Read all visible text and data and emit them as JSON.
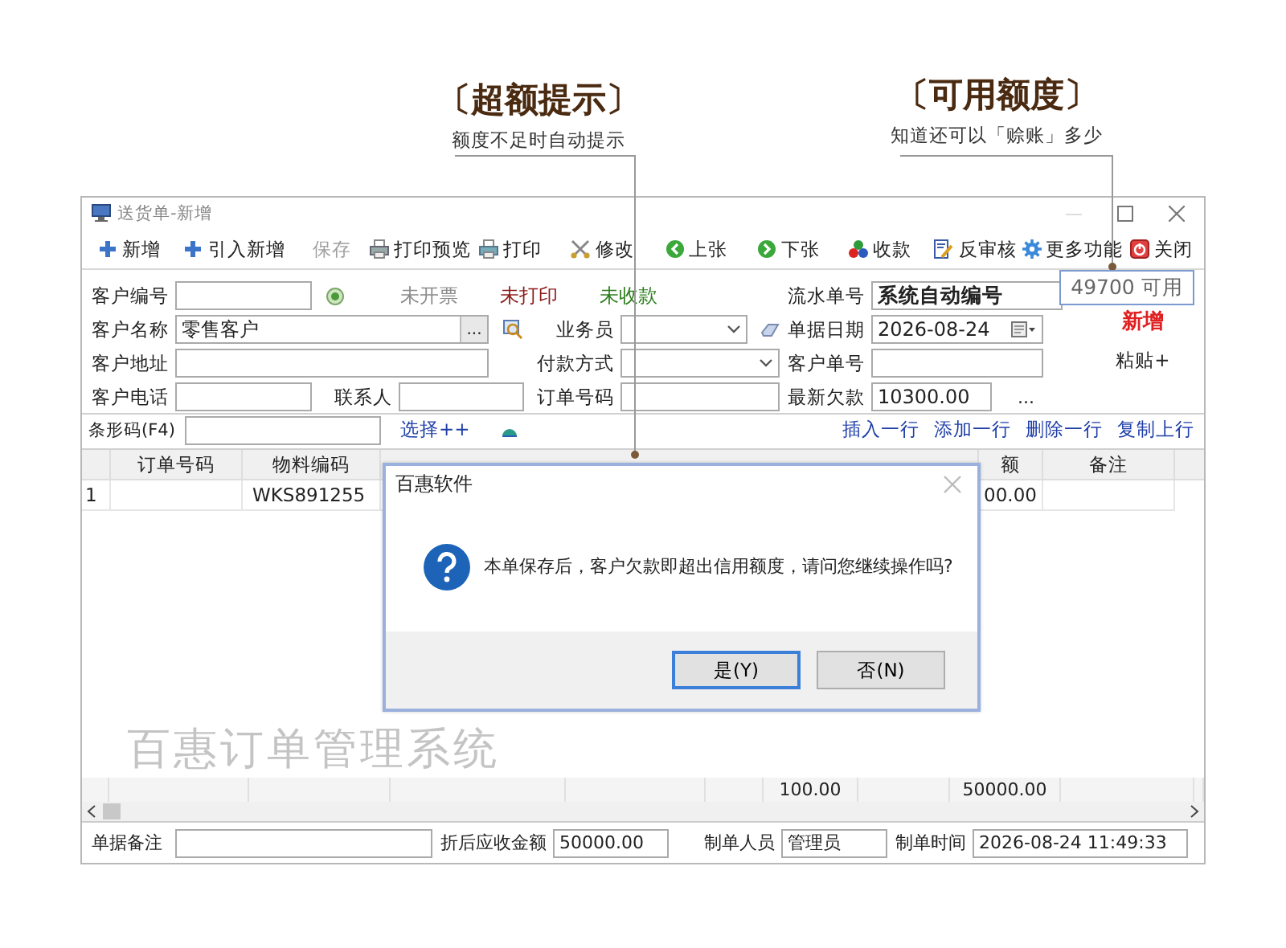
{
  "annotations": [
    {
      "title": "〔超额提示〕",
      "subtitle": "额度不足时自动提示"
    },
    {
      "title": "〔可用额度〕",
      "subtitle": "知道还可以「赊账」多少"
    }
  ],
  "available_hint": "49700 可用",
  "window": {
    "title": "送货单-新增"
  },
  "toolbar": [
    {
      "label": "新增",
      "disabled": false
    },
    {
      "label": "引入新增",
      "disabled": false
    },
    {
      "label": "保存",
      "disabled": true
    },
    {
      "label": "打印预览",
      "disabled": false
    },
    {
      "label": "打印",
      "disabled": false
    },
    {
      "label": "修改",
      "disabled": false
    },
    {
      "label": "上张",
      "disabled": false
    },
    {
      "label": "下张",
      "disabled": false
    },
    {
      "label": "收款",
      "disabled": false
    },
    {
      "label": "反审核",
      "disabled": false
    },
    {
      "label": "更多功能",
      "disabled": false
    },
    {
      "label": "关闭",
      "disabled": false
    }
  ],
  "status_flags": [
    {
      "label": "未开票",
      "color": "#8c8c8c"
    },
    {
      "label": "未打印",
      "color": "#8b1a1a"
    },
    {
      "label": "未收款",
      "color": "#2e7d1e"
    }
  ],
  "form": {
    "fields": [
      {
        "kind": "text",
        "label": "客户编号"
      },
      {
        "kind": "text",
        "label": "流水单号",
        "value": "系统自动编号",
        "bold": true
      },
      {
        "kind": "lookup",
        "label": "客户名称",
        "value": "零售客户",
        "button": "..."
      },
      {
        "kind": "select",
        "label": "业务员"
      },
      {
        "kind": "date",
        "label": "单据日期",
        "value": "2026-08-24"
      },
      {
        "kind": "text",
        "label": "客户地址"
      },
      {
        "kind": "select",
        "label": "付款方式"
      },
      {
        "kind": "text",
        "label": "客户单号"
      },
      {
        "kind": "text",
        "label": "客户电话"
      },
      {
        "kind": "text",
        "label": "联系人"
      },
      {
        "kind": "text",
        "label": "订单号码"
      },
      {
        "kind": "text",
        "label": "最新欠款",
        "value": "10300.00"
      }
    ],
    "more_button": "...",
    "mode_badge": "新增",
    "paste_link": "粘贴+"
  },
  "barcode": {
    "label": "条形码(F4)",
    "select_link": "选择++"
  },
  "row_actions": [
    "插入一行",
    "添加一行",
    "删除一行",
    "复制上行"
  ],
  "table": {
    "columns": [
      "订单号码",
      "物料编码",
      "额",
      "备注"
    ],
    "rows": [
      {
        "row_number": "1",
        "material_code": "WKS891255",
        "column_3": "00.00"
      }
    ],
    "totals": {
      "total_1": "100.00",
      "total_2": "50000.00"
    },
    "watermark": "百惠订单管理系统"
  },
  "footer": [
    {
      "label": "单据备注"
    },
    {
      "label": "折后应收金额",
      "value": "50000.00"
    },
    {
      "label": "制单人员",
      "value": "管理员"
    },
    {
      "label": "制单时间",
      "value": "2026-08-24 11:49:33"
    }
  ],
  "dialog": {
    "title": "百惠软件",
    "message": "本单保存后，客户欠款即超出信用额度，请问您继续操作吗?",
    "buttons": [
      {
        "label": "是(Y)",
        "default": true
      },
      {
        "label": "否(N)",
        "default": false
      }
    ]
  }
}
